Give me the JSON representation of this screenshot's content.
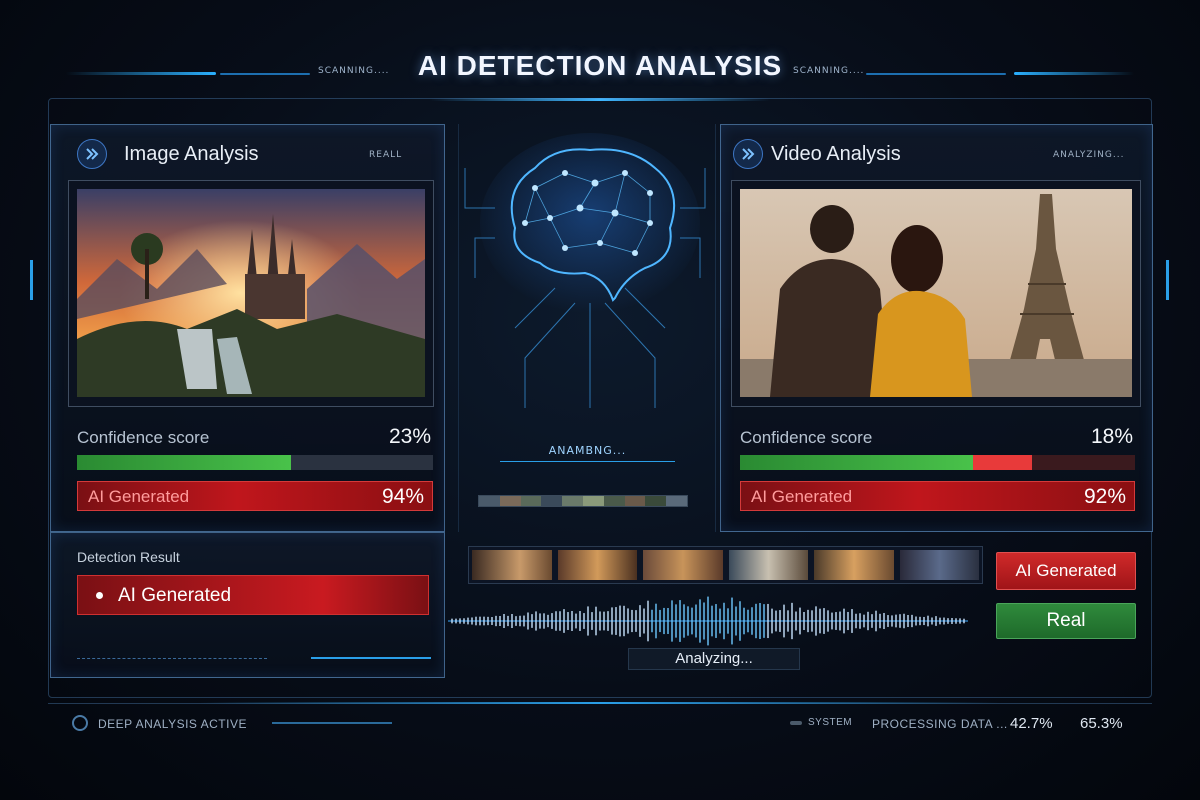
{
  "header": {
    "title": "AI DETECTION ANALYSIS",
    "scan_left": "SCANNING....",
    "scan_right": "SCANNING...."
  },
  "image_panel": {
    "title": "Image Analysis",
    "tag": "REALL",
    "confidence_label": "Confidence score",
    "confidence_value": "23%",
    "confidence_fraction": 0.6,
    "ai_label": "AI Generated",
    "ai_value": "94%",
    "detection_label": "Detection Result",
    "detection_value": "AI Generated"
  },
  "center": {
    "status": "ANAMBNG..."
  },
  "video_panel": {
    "title": "Video Analysis",
    "tag": "ANALYZING...",
    "confidence_label": "Confidence score",
    "confidence_value": "18%",
    "confidence_green_fraction": 0.59,
    "confidence_red_fraction": 0.15,
    "ai_label": "AI Generated",
    "ai_value": "92%"
  },
  "results": {
    "ai_button": "AI Generated",
    "real_button": "Real",
    "analyzing": "Analyzing..."
  },
  "footer": {
    "left": "DEEP ANALYSIS ACTIVE",
    "system": "SYSTEM",
    "processing": "PROCESSING DATA ...",
    "stat_1": "42.7%",
    "stat_2": "65.3%"
  },
  "colors": {
    "accent_blue": "#2fa8ff",
    "alert_red": "#c0161c",
    "ok_green": "#2e8b3a"
  }
}
